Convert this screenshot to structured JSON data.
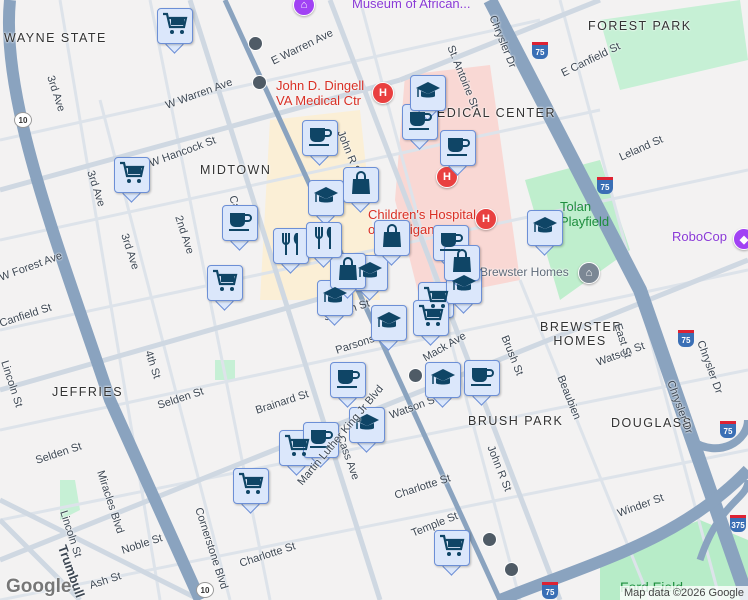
{
  "neighborhoods": [
    "WAYNE STATE",
    "MIDTOWN",
    "MEDICAL CENTER",
    "FOREST PARK",
    "BREWSTER HOMES",
    "JEFFRIES",
    "BRUSH PARK",
    "DOUGLASS"
  ],
  "streets": [
    "E Warren Ave",
    "W Warren Ave",
    "W Hancock St",
    "3rd Ave",
    "3rd Ave",
    "3rd Ave",
    "2nd Ave",
    "Cass Ave",
    "John R St",
    "St. Antoine St",
    "Chrysler Dr",
    "E Canfield St",
    "Leland St",
    "W Forest Ave",
    "Canfield St",
    "Lincoln St",
    "4th St",
    "Selden St",
    "Selden St",
    "Brainard St",
    "Miracles Blvd",
    "Lincoln St",
    "Noble St",
    "Cornerstone Blvd",
    "Charlotte St",
    "Charlotte St",
    "Temple St",
    "Mack Ave",
    "Brush St",
    "Beaubien",
    "Watson St",
    "East St",
    "Chrysler Dr",
    "Chrysler Dr",
    "Winder St",
    "Trumbull",
    "Ash St",
    "Parsons St",
    "Selden St",
    "Cass Ave",
    "Martin Luther King Jr Blvd",
    "Watson St",
    "John R St"
  ],
  "pois": {
    "museum": "Museum of African...",
    "va": "John D. Dingell\nVA Medical Ctr",
    "childrens": "Children's Hospital\nof Michigan",
    "tolan": "Tolan\nPlayfield",
    "robocop": "RoboCop",
    "brewster": "Brewster Homes",
    "ford": "Ford Field"
  },
  "highway_shields": [
    "10",
    "75",
    "75",
    "75",
    "75",
    "375",
    "10",
    "75"
  ],
  "markers": [
    {
      "type": "cart"
    },
    {
      "type": "cart"
    },
    {
      "type": "cart"
    },
    {
      "type": "cart"
    },
    {
      "type": "cart"
    },
    {
      "type": "cart"
    },
    {
      "type": "cart"
    },
    {
      "type": "cart"
    },
    {
      "type": "coffee"
    },
    {
      "type": "coffee"
    },
    {
      "type": "coffee"
    },
    {
      "type": "coffee"
    },
    {
      "type": "coffee"
    },
    {
      "type": "coffee"
    },
    {
      "type": "coffee"
    },
    {
      "type": "coffee"
    },
    {
      "type": "grad"
    },
    {
      "type": "grad"
    },
    {
      "type": "grad"
    },
    {
      "type": "grad"
    },
    {
      "type": "grad"
    },
    {
      "type": "grad"
    },
    {
      "type": "grad"
    },
    {
      "type": "grad"
    },
    {
      "type": "grad"
    },
    {
      "type": "bag"
    },
    {
      "type": "bag"
    },
    {
      "type": "bag"
    },
    {
      "type": "bag"
    },
    {
      "type": "restaurant"
    },
    {
      "type": "restaurant"
    }
  ],
  "google_logo": "Google",
  "attribution": "Map data ©2026 Google",
  "colors": {
    "marker_fill": "#dbe7fb",
    "marker_border": "#6c8fd6",
    "icon": "#0f4566",
    "highway": "#8aa3bf",
    "road": "#d5dde5",
    "medical": "#f9d8d4",
    "park": "#b7ecc8"
  }
}
